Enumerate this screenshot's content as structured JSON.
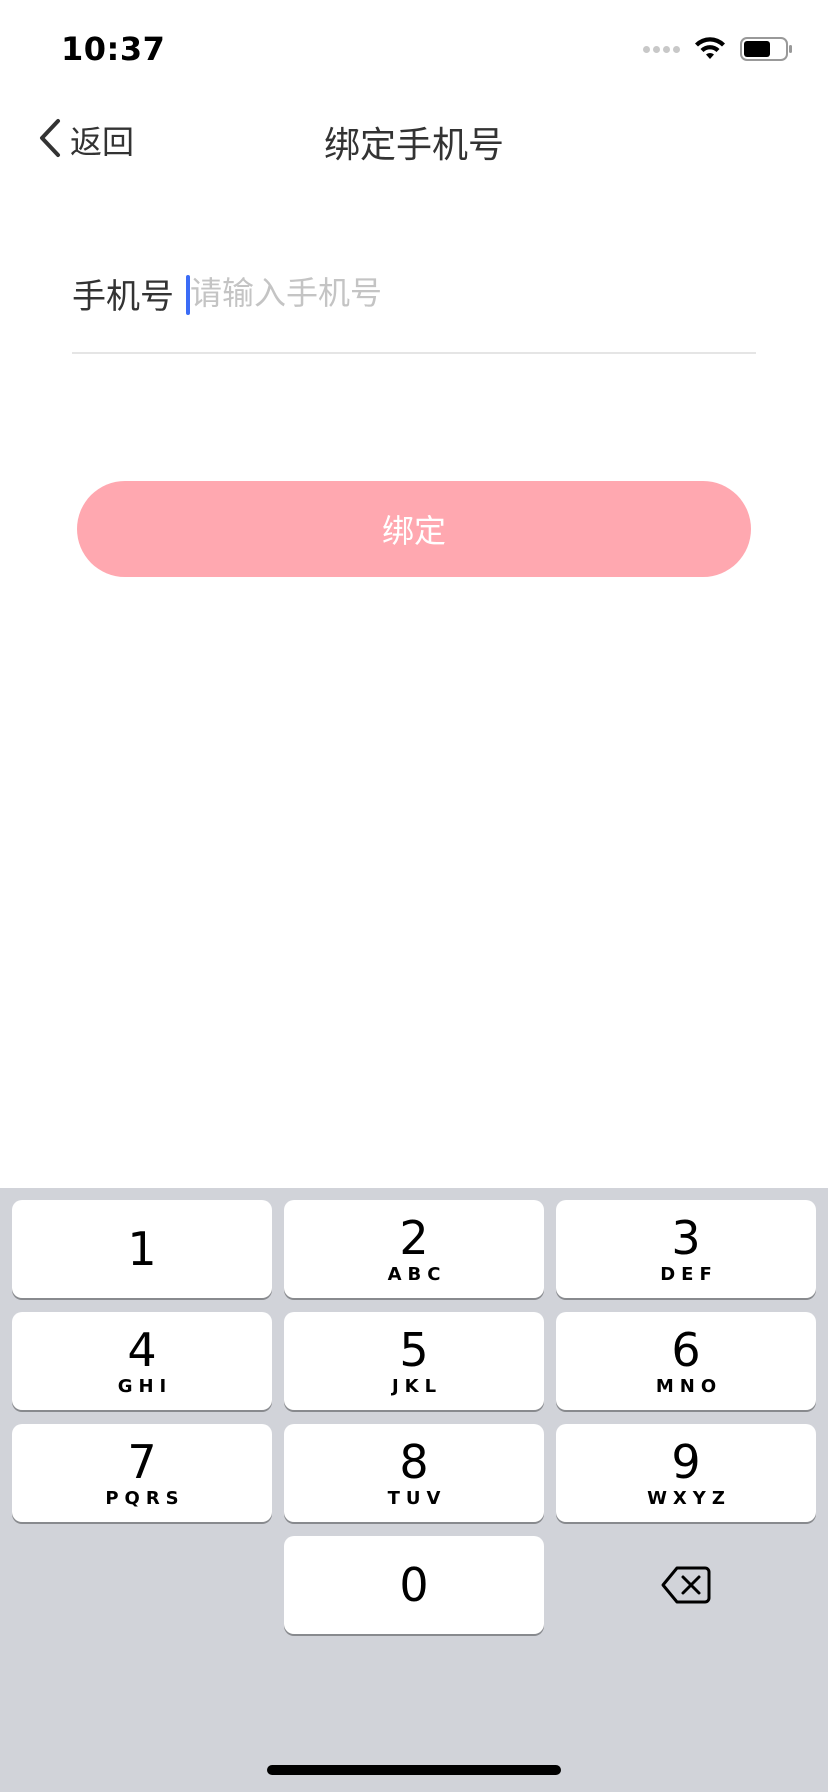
{
  "status_bar": {
    "time": "10:37",
    "icons": [
      "signal-icon",
      "wifi-icon",
      "battery-icon"
    ]
  },
  "nav": {
    "back_label": "返回",
    "title": "绑定手机号"
  },
  "form": {
    "phone_label": "手机号",
    "phone_placeholder": "请输入手机号",
    "phone_value": ""
  },
  "bind_button": {
    "label": "绑定",
    "color": "#ffa8b0"
  },
  "colors": {
    "caret": "#3b6cf6",
    "keyboard_bg": "#d1d3d9"
  },
  "keyboard": {
    "keys": [
      {
        "digit": "1",
        "letters": ""
      },
      {
        "digit": "2",
        "letters": "ABC"
      },
      {
        "digit": "3",
        "letters": "DEF"
      },
      {
        "digit": "4",
        "letters": "GHI"
      },
      {
        "digit": "5",
        "letters": "JKL"
      },
      {
        "digit": "6",
        "letters": "MNO"
      },
      {
        "digit": "7",
        "letters": "PQRS"
      },
      {
        "digit": "8",
        "letters": "TUV"
      },
      {
        "digit": "9",
        "letters": "WXYZ"
      },
      {
        "digit": "0",
        "letters": ""
      }
    ],
    "delete_icon": "backspace-icon"
  }
}
